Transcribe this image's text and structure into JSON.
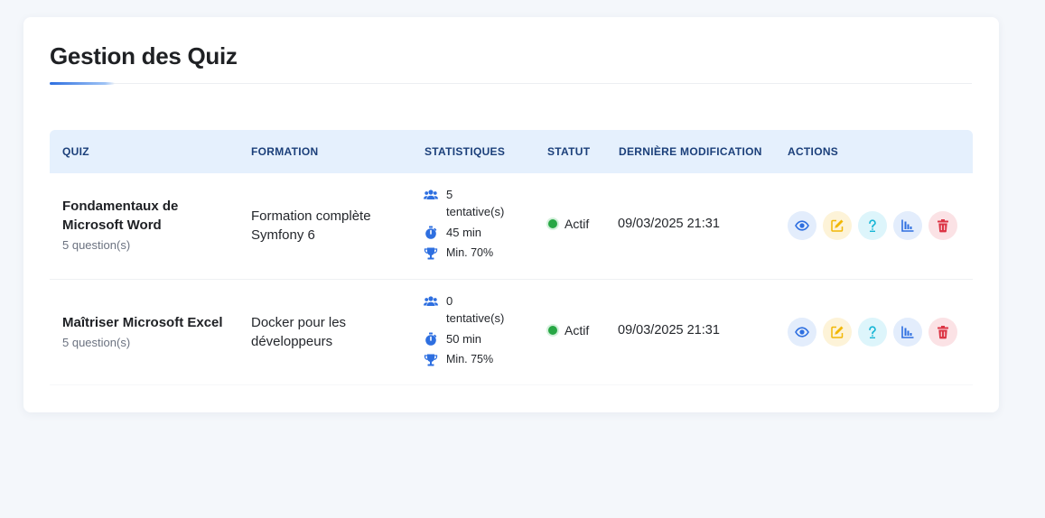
{
  "page": {
    "title": "Gestion des Quiz"
  },
  "table": {
    "headers": {
      "quiz": "QUIZ",
      "formation": "FORMATION",
      "stats": "STATISTIQUES",
      "status": "STATUT",
      "modified": "DERNIÈRE MODIFICATION",
      "actions": "ACTIONS"
    },
    "rows": [
      {
        "title": "Fondamentaux de Microsoft Word",
        "questions": "5 question(s)",
        "formation": "Formation complète Symfony 6",
        "attempts_count": "5",
        "attempts_label": "tentative(s)",
        "duration": "45 min",
        "min_score": "Min. 70%",
        "status": "Actif",
        "modified": "09/03/2025 21:31"
      },
      {
        "title": "Maîtriser Microsoft Excel",
        "questions": "5 question(s)",
        "formation": "Docker pour les développeurs",
        "attempts_count": "0",
        "attempts_label": "tentative(s)",
        "duration": "50 min",
        "min_score": "Min. 75%",
        "status": "Actif",
        "modified": "09/03/2025 21:31"
      }
    ]
  },
  "icons": {
    "attempts": "users-icon",
    "duration": "stopwatch-icon",
    "min_score": "trophy-icon",
    "view": "eye-icon",
    "edit": "edit-icon",
    "questions": "question-icon",
    "stats": "bar-chart-icon",
    "delete": "trash-icon"
  },
  "colors": {
    "accent": "#2e6fe0",
    "header_bg": "#e5f0fd",
    "header_text": "#1b3f7a",
    "active": "#28a745",
    "view": "#2e6fe0",
    "edit": "#f2b705",
    "questions": "#17b6d6",
    "delete": "#dc3545"
  }
}
